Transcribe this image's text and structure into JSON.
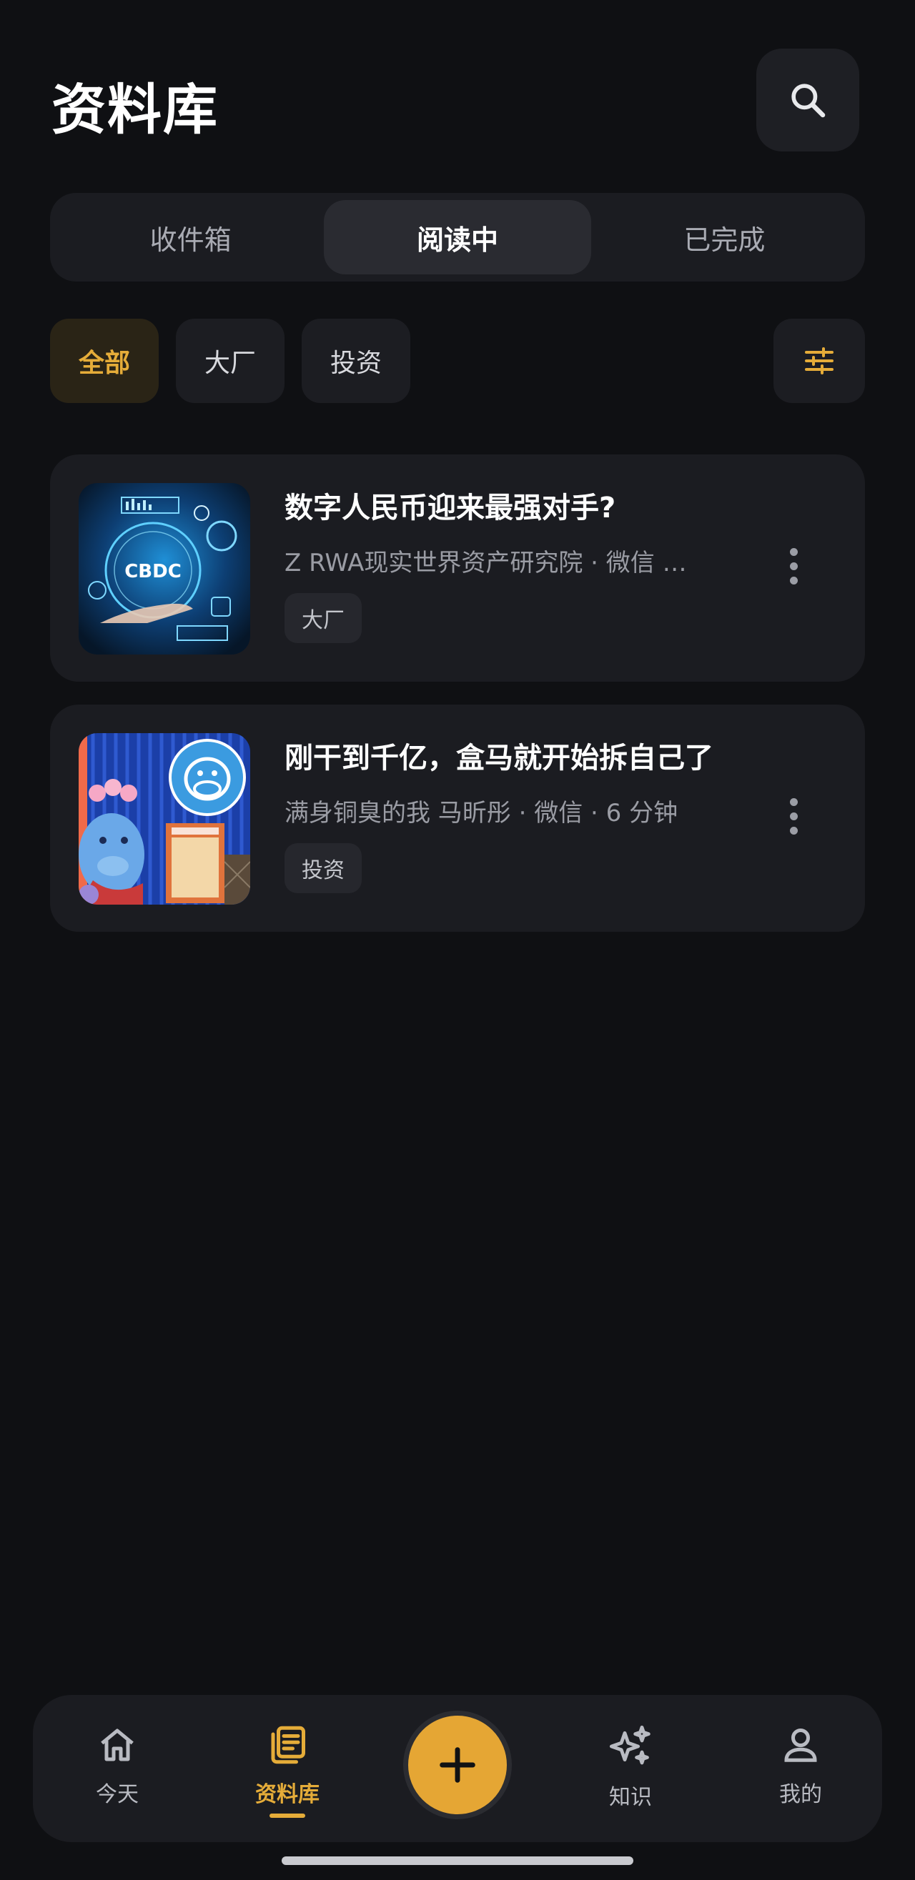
{
  "header": {
    "title": "资料库",
    "search_icon": "search-icon"
  },
  "tabs": [
    {
      "label": "收件箱",
      "active": false
    },
    {
      "label": "阅读中",
      "active": true
    },
    {
      "label": "已完成",
      "active": false
    }
  ],
  "filters": {
    "chips": [
      {
        "label": "全部",
        "active": true
      },
      {
        "label": "大厂",
        "active": false
      },
      {
        "label": "投资",
        "active": false
      }
    ],
    "settings_icon": "sliders-icon"
  },
  "articles": [
    {
      "title": "数字人民币迎来最强对手?",
      "meta": "Z RWA现实世界资产研究院  ·  微信 …",
      "tag": "大厂",
      "thumb_text": "CBDC",
      "thumb_icon": "cbdc-image"
    },
    {
      "title": "刚干到千亿，盒马就开始拆自己了",
      "meta": "满身铜臭的我 马昕彤  ·  微信 · 6 分钟",
      "tag": "投资",
      "thumb_icon": "hippo-image"
    }
  ],
  "bottom_nav": {
    "items": [
      {
        "label": "今天",
        "icon": "home-icon",
        "active": false
      },
      {
        "label": "资料库",
        "icon": "library-icon",
        "active": true
      },
      {
        "label": "知识",
        "icon": "sparkle-icon",
        "active": false
      },
      {
        "label": "我的",
        "icon": "profile-icon",
        "active": false
      }
    ],
    "fab_icon": "plus-icon"
  },
  "colors": {
    "accent": "#e5ac39",
    "background": "#0f1013",
    "card": "#1b1c21"
  }
}
